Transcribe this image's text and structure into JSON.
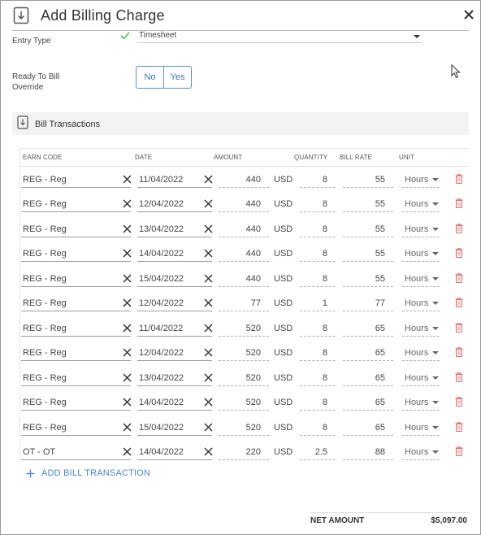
{
  "dialog": {
    "title": "Add Billing Charge",
    "icon": "download-doc-icon",
    "close_icon": "close-icon"
  },
  "form": {
    "entry_type_label": "Entry Type",
    "entry_type_value": "Timesheet",
    "ready_to_bill_label_line1": "Ready To Bill",
    "ready_to_bill_label_line2": "Override",
    "toggle_no": "No",
    "toggle_yes": "Yes"
  },
  "section": {
    "title": "Bill Transactions",
    "icon": "download-doc-icon"
  },
  "table": {
    "headers": {
      "earn_code": "EARN CODE",
      "date": "DATE",
      "amount": "AMOUNT",
      "quantity": "QUANTITY",
      "bill_rate": "BILL RATE",
      "unit": "UNIT"
    },
    "rows": [
      {
        "earn_code": "REG - Reg",
        "date": "11/04/2022",
        "amount": "440",
        "currency": "USD",
        "quantity": "8",
        "bill_rate": "55",
        "unit": "Hours"
      },
      {
        "earn_code": "REG - Reg",
        "date": "12/04/2022",
        "amount": "440",
        "currency": "USD",
        "quantity": "8",
        "bill_rate": "55",
        "unit": "Hours"
      },
      {
        "earn_code": "REG - Reg",
        "date": "13/04/2022",
        "amount": "440",
        "currency": "USD",
        "quantity": "8",
        "bill_rate": "55",
        "unit": "Hours"
      },
      {
        "earn_code": "REG - Reg",
        "date": "14/04/2022",
        "amount": "440",
        "currency": "USD",
        "quantity": "8",
        "bill_rate": "55",
        "unit": "Hours"
      },
      {
        "earn_code": "REG - Reg",
        "date": "15/04/2022",
        "amount": "440",
        "currency": "USD",
        "quantity": "8",
        "bill_rate": "55",
        "unit": "Hours"
      },
      {
        "earn_code": "REG - Reg",
        "date": "12/04/2022",
        "amount": "77",
        "currency": "USD",
        "quantity": "1",
        "bill_rate": "77",
        "unit": "Hours"
      },
      {
        "earn_code": "REG - Reg",
        "date": "11/04/2022",
        "amount": "520",
        "currency": "USD",
        "quantity": "8",
        "bill_rate": "65",
        "unit": "Hours"
      },
      {
        "earn_code": "REG - Reg",
        "date": "12/04/2022",
        "amount": "520",
        "currency": "USD",
        "quantity": "8",
        "bill_rate": "65",
        "unit": "Hours"
      },
      {
        "earn_code": "REG - Reg",
        "date": "13/04/2022",
        "amount": "520",
        "currency": "USD",
        "quantity": "8",
        "bill_rate": "65",
        "unit": "Hours"
      },
      {
        "earn_code": "REG - Reg",
        "date": "14/04/2022",
        "amount": "520",
        "currency": "USD",
        "quantity": "8",
        "bill_rate": "65",
        "unit": "Hours"
      },
      {
        "earn_code": "REG - Reg",
        "date": "15/04/2022",
        "amount": "520",
        "currency": "USD",
        "quantity": "8",
        "bill_rate": "65",
        "unit": "Hours"
      },
      {
        "earn_code": "OT - OT",
        "date": "14/04/2022",
        "amount": "220",
        "currency": "USD",
        "quantity": "2.5",
        "bill_rate": "88",
        "unit": "Hours"
      }
    ]
  },
  "add_transaction_label": "ADD BILL TRANSACTION",
  "totals": {
    "net_amount_label": "NET AMOUNT",
    "net_amount_value": "$5,097.00"
  },
  "colors": {
    "accent_blue": "#4a86d1",
    "trash_red": "#e06464",
    "check_green": "#5cb85c"
  }
}
